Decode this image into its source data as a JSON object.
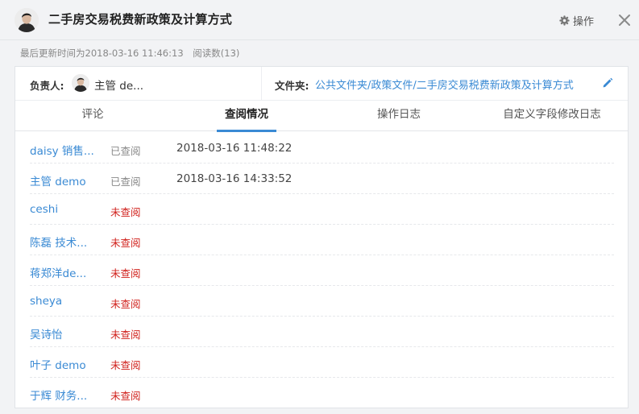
{
  "header": {
    "title": "二手房交易税费新政策及计算方式",
    "op_label": "操作",
    "icons": {
      "gear": "gear-icon",
      "close": "close-icon"
    }
  },
  "meta": {
    "updated": "最后更新时间为2018-03-16 11:46:13",
    "reads": "阅读数(13)"
  },
  "info": {
    "owner_label": "负责人:",
    "owner_name": "主管 de...",
    "folder_label": "文件夹:",
    "folder_path": "公共文件夹/政策文件/二手房交易税费新政策及计算方式",
    "icons": {
      "edit": "pencil-icon"
    }
  },
  "tabs": [
    {
      "label": "评论",
      "active": false
    },
    {
      "label": "查阅情况",
      "active": true
    },
    {
      "label": "操作日志",
      "active": false
    },
    {
      "label": "自定义字段修改日志",
      "active": false
    }
  ],
  "rows": [
    {
      "name": "daisy 销售...",
      "status": "已查阅",
      "read": true,
      "time": "2018-03-16 11:48:22"
    },
    {
      "name": "主管 demo",
      "status": "已查阅",
      "read": true,
      "time": "2018-03-16 14:33:52"
    },
    {
      "name": "ceshi",
      "status": "未查阅",
      "read": false,
      "time": ""
    },
    {
      "name": "陈磊 技术...",
      "status": "未查阅",
      "read": false,
      "time": ""
    },
    {
      "name": "蒋郑洋de...",
      "status": "未查阅",
      "read": false,
      "time": ""
    },
    {
      "name": "sheya",
      "status": "未查阅",
      "read": false,
      "time": ""
    },
    {
      "name": "吴诗怡",
      "status": "未查阅",
      "read": false,
      "time": ""
    },
    {
      "name": "叶子 demo",
      "status": "未查阅",
      "read": false,
      "time": ""
    },
    {
      "name": "于辉 财务...",
      "status": "未查阅",
      "read": false,
      "time": ""
    }
  ],
  "colors": {
    "accent": "#3a8ad4",
    "unread": "#d0211c",
    "read": "#888888"
  }
}
